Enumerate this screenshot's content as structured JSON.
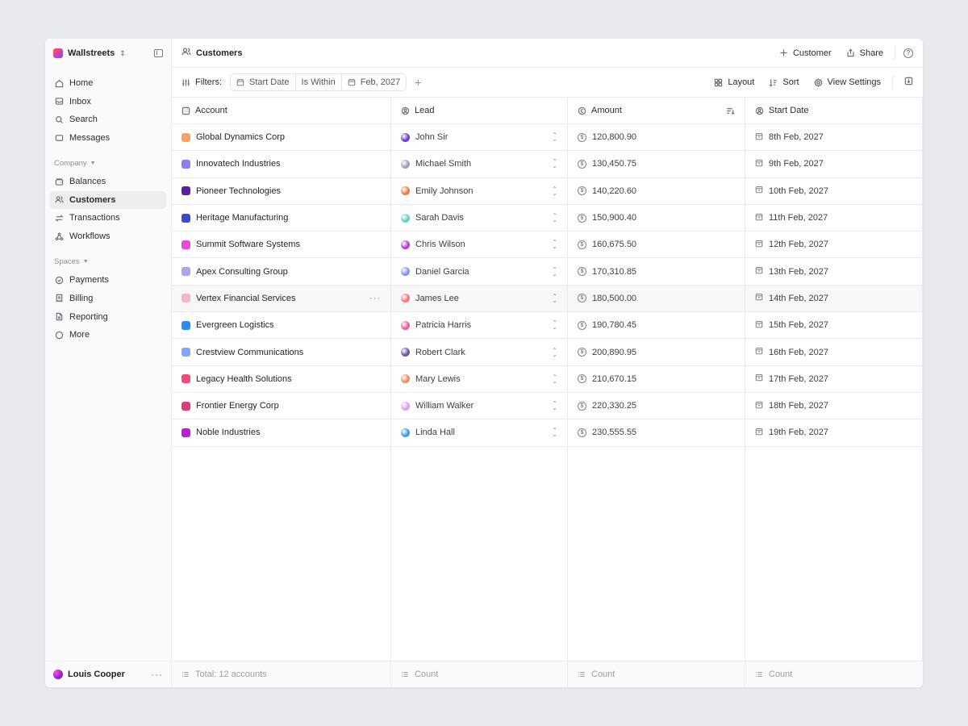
{
  "workspace": {
    "name": "Wallstreets"
  },
  "nav": {
    "main": [
      {
        "label": "Home",
        "icon": "home-icon"
      },
      {
        "label": "Inbox",
        "icon": "inbox-icon"
      },
      {
        "label": "Search",
        "icon": "search-icon"
      },
      {
        "label": "Messages",
        "icon": "message-icon"
      }
    ],
    "company_label": "Company",
    "company": [
      {
        "label": "Balances",
        "icon": "wallet-icon"
      },
      {
        "label": "Customers",
        "icon": "users-icon",
        "active": true
      },
      {
        "label": "Transactions",
        "icon": "transfer-icon"
      },
      {
        "label": "Workflows",
        "icon": "workflow-icon"
      }
    ],
    "spaces_label": "Spaces",
    "spaces": [
      {
        "label": "Payments",
        "icon": "check-circle-icon"
      },
      {
        "label": "Billing",
        "icon": "receipt-icon"
      },
      {
        "label": "Reporting",
        "icon": "document-icon"
      },
      {
        "label": "More",
        "icon": "more-circle-icon"
      }
    ]
  },
  "user": {
    "name": "Louis Cooper"
  },
  "header": {
    "title": "Customers",
    "add_customer": "Customer",
    "share": "Share"
  },
  "filters": {
    "label": "Filters:",
    "field": "Start Date",
    "operator": "Is Within",
    "value": "Feb, 2027",
    "layout": "Layout",
    "sort": "Sort",
    "view_settings": "View Settings"
  },
  "table": {
    "columns": [
      "Account",
      "Lead",
      "Amount",
      "Start Date"
    ],
    "rows": [
      {
        "account": "Global Dynamics Corp",
        "lead": "John Sir",
        "amount": "120,800.90",
        "date": "8th Feb, 2027"
      },
      {
        "account": "Innovatech Industries",
        "lead": "Michael Smith",
        "amount": "130,450.75",
        "date": "9th Feb, 2027"
      },
      {
        "account": "Pioneer Technologies",
        "lead": "Emily Johnson",
        "amount": "140,220.60",
        "date": "10th Feb, 2027"
      },
      {
        "account": "Heritage Manufacturing",
        "lead": "Sarah Davis",
        "amount": "150,900.40",
        "date": "11th Feb, 2027"
      },
      {
        "account": "Summit Software Systems",
        "lead": "Chris Wilson",
        "amount": "160,675.50",
        "date": "12th Feb, 2027"
      },
      {
        "account": "Apex Consulting Group",
        "lead": "Daniel Garcia",
        "amount": "170,310.85",
        "date": "13th Feb, 2027"
      },
      {
        "account": "Vertex Financial Services",
        "lead": "James Lee",
        "amount": "180,500.00",
        "date": "14th Feb, 2027"
      },
      {
        "account": "Evergreen Logistics",
        "lead": "Patricia Harris",
        "amount": "190,780.45",
        "date": "15th Feb, 2027"
      },
      {
        "account": "Crestview Communications",
        "lead": "Robert Clark",
        "amount": "200,890.95",
        "date": "16th Feb, 2027"
      },
      {
        "account": "Legacy Health Solutions",
        "lead": "Mary Lewis",
        "amount": "210,670.15",
        "date": "17th Feb, 2027"
      },
      {
        "account": "Frontier Energy Corp",
        "lead": "William Walker",
        "amount": "220,330.25",
        "date": "18th Feb, 2027"
      },
      {
        "account": "Noble Industries",
        "lead": "Linda Hall",
        "amount": "230,555.55",
        "date": "19th Feb, 2027"
      }
    ],
    "footer": {
      "total": "Total: 12 accounts",
      "count": "Count"
    }
  },
  "colors": {
    "accounts": [
      "#f6a36b",
      "#8f7df5",
      "#5a1f9e",
      "#3b4bd1",
      "#e84ad8",
      "#a8a5f6",
      "#f4b7c7",
      "#2e8af0",
      "#7fa7f7",
      "#f24b79",
      "#d93d7c",
      "#b91fd9"
    ],
    "leads": [
      "#6a3bd8",
      "#9aa2b4",
      "#f07a3a",
      "#5fd3c4",
      "#b23be0",
      "#7f92f1",
      "#f27a7a",
      "#e8609b",
      "#6f4fa5",
      "#f08a5d",
      "#d9a0f0",
      "#3b9de8"
    ]
  }
}
